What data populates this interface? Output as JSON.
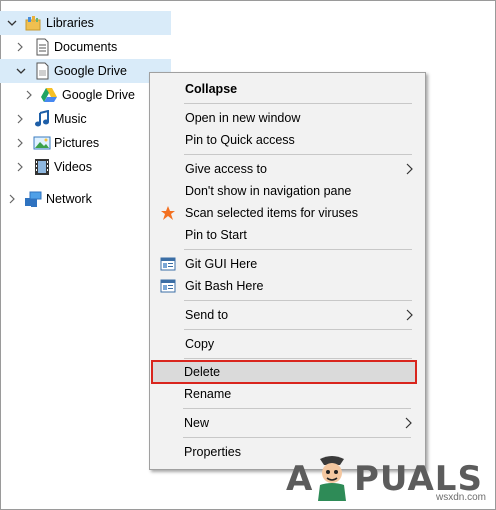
{
  "tree": {
    "items": [
      {
        "label": "Libraries",
        "icon": "libraries-icon"
      },
      {
        "label": "Documents",
        "icon": "documents-icon"
      },
      {
        "label": "Google Drive",
        "icon": "google-drive-library-icon"
      },
      {
        "label": "Google Drive",
        "icon": "google-drive-icon"
      },
      {
        "label": "Music",
        "icon": "music-icon"
      },
      {
        "label": "Pictures",
        "icon": "pictures-icon"
      },
      {
        "label": "Videos",
        "icon": "videos-icon"
      },
      {
        "label": "Network",
        "icon": "network-icon"
      }
    ],
    "selected_color": "#d9ebf9"
  },
  "menu": {
    "collapse": "Collapse",
    "open_new_window": "Open in new window",
    "pin_quick_access": "Pin to Quick access",
    "give_access": "Give access to",
    "dont_show": "Don't show in navigation pane",
    "scan": "Scan selected items for viruses",
    "pin_start": "Pin to Start",
    "git_gui": "Git GUI Here",
    "git_bash": "Git Bash Here",
    "send_to": "Send to",
    "copy": "Copy",
    "delete": "Delete",
    "rename": "Rename",
    "new": "New",
    "properties": "Properties",
    "highlight_color": "#d9251d"
  },
  "watermark": {
    "letter_a": "A",
    "letters_rest": "PUALS",
    "site": "wsxdn.com"
  }
}
